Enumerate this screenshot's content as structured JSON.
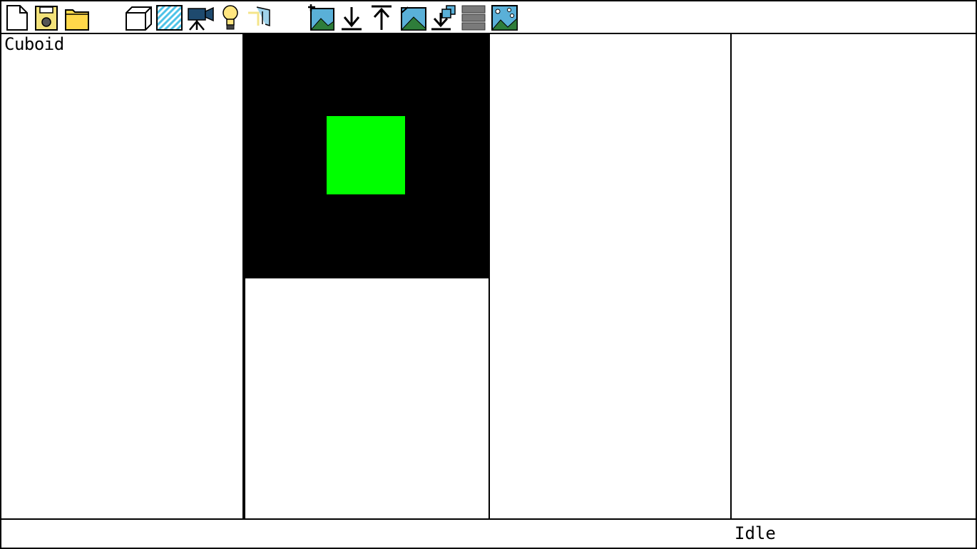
{
  "toolbar": {
    "buttons": [
      {
        "id": "new-file",
        "icon": "new-file-icon"
      },
      {
        "id": "save",
        "icon": "save-disk-icon"
      },
      {
        "id": "open",
        "icon": "open-folder-icon"
      },
      {
        "id": "add-cuboid",
        "icon": "cube-icon"
      },
      {
        "id": "add-plane",
        "icon": "textured-plane-icon"
      },
      {
        "id": "add-camera",
        "icon": "camera-icon"
      },
      {
        "id": "add-light",
        "icon": "light-bulb-icon"
      },
      {
        "id": "add-portal",
        "icon": "portal-icon"
      },
      {
        "id": "add-texture",
        "icon": "add-image-icon"
      },
      {
        "id": "import",
        "icon": "arrow-down-icon"
      },
      {
        "id": "export",
        "icon": "arrow-up-icon"
      },
      {
        "id": "render-image",
        "icon": "render-image-icon"
      },
      {
        "id": "batch-import",
        "icon": "batch-import-icon"
      },
      {
        "id": "layers",
        "icon": "layers-icon"
      },
      {
        "id": "scene-preview",
        "icon": "scene-preview-icon"
      }
    ]
  },
  "left_panel": {
    "object_name": "Cuboid"
  },
  "viewport": {
    "background": "#000000",
    "object_color": "#00ff00"
  },
  "status": {
    "text": "Idle"
  }
}
